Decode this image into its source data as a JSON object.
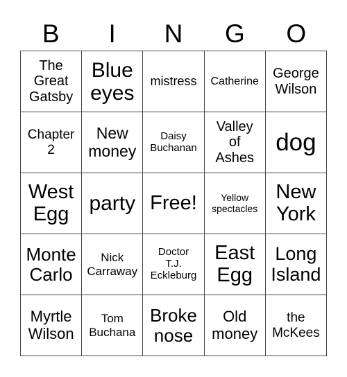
{
  "header": [
    "B",
    "I",
    "N",
    "G",
    "O"
  ],
  "rows": [
    [
      "The\nGreat\nGatsby",
      "Blue\neyes",
      "mistress",
      "Catherine",
      "George\nWilson"
    ],
    [
      "Chapter\n2",
      "New\nmoney",
      "Daisy\nBuchanan",
      "Valley\nof\nAshes",
      "dog"
    ],
    [
      "West\nEgg",
      "party",
      "Free!",
      "Yellow\nspectacles",
      "New\nYork"
    ],
    [
      "Monte\nCarlo",
      "Nick\nCarraway",
      "Doctor\nT.J.\nEckleburg",
      "East\nEgg",
      "Long\nIsland"
    ],
    [
      "Myrtle\nWilson",
      "Tom\nBuchana",
      "Broke\nnose",
      "Old\nmoney",
      "the\nMcKees"
    ]
  ]
}
